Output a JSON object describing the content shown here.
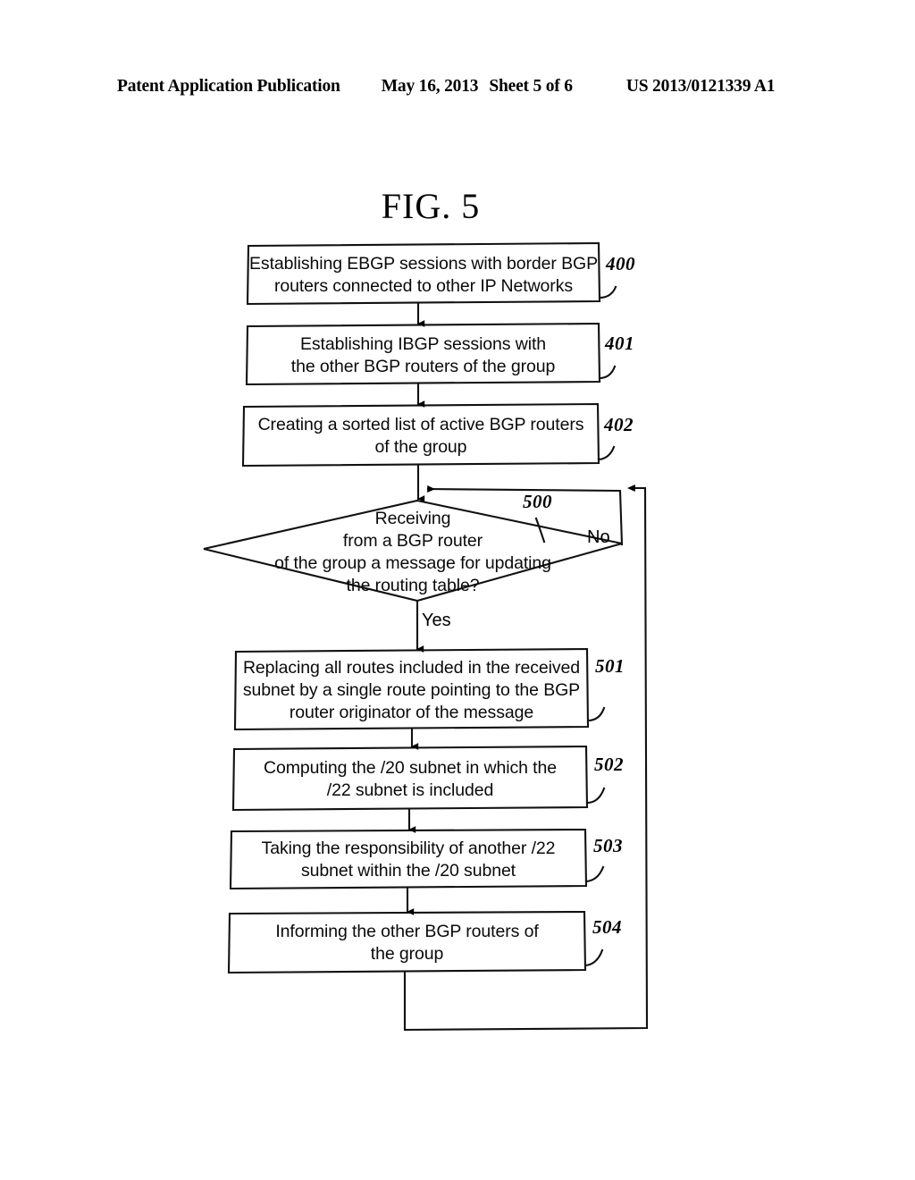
{
  "header": {
    "publication": "Patent Application Publication",
    "date": "May 16, 2013",
    "sheet": "Sheet 5 of 6",
    "patent_number": "US 2013/0121339 A1"
  },
  "figure": {
    "title": "FIG. 5"
  },
  "flowchart": {
    "nodes": [
      {
        "id": "400",
        "type": "process",
        "ref": "400",
        "lines": [
          "Establishing EBGP sessions with border BGP",
          "routers connected to other IP Networks"
        ]
      },
      {
        "id": "401",
        "type": "process",
        "ref": "401",
        "lines": [
          "Establishing IBGP sessions with",
          "the other BGP routers of the group"
        ]
      },
      {
        "id": "402",
        "type": "process",
        "ref": "402",
        "lines": [
          "Creating a sorted list of active BGP routers",
          "of the group"
        ]
      },
      {
        "id": "500",
        "type": "decision",
        "ref": "500",
        "lines": [
          "Receiving",
          "from a BGP router",
          "of the group a message for updating",
          "the routing table?"
        ]
      },
      {
        "id": "501",
        "type": "process",
        "ref": "501",
        "lines": [
          "Replacing all routes included in the received",
          "subnet by a single route pointing to the BGP",
          "router originator of the message"
        ]
      },
      {
        "id": "502",
        "type": "process",
        "ref": "502",
        "lines": [
          "Computing the /20 subnet in which the",
          "/22 subnet is included"
        ]
      },
      {
        "id": "503",
        "type": "process",
        "ref": "503",
        "lines": [
          "Taking the responsibility of another /22",
          "subnet within the /20 subnet"
        ]
      },
      {
        "id": "504",
        "type": "process",
        "ref": "504",
        "lines": [
          "Informing the other BGP routers of",
          "the group"
        ]
      }
    ],
    "branch_labels": {
      "yes": "Yes",
      "no": "No"
    }
  }
}
